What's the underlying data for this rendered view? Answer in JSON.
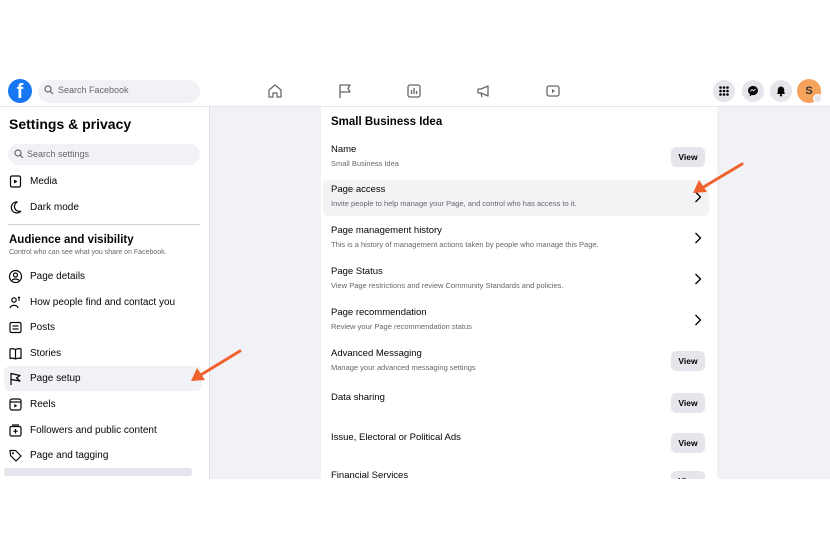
{
  "topbar": {
    "logo_letter": "f",
    "search_placeholder": "Search Facebook",
    "avatar_letter": "S"
  },
  "sidebar": {
    "title": "Settings & privacy",
    "search_placeholder": "Search settings",
    "top_items": [
      {
        "label": "Media",
        "icon": "media-icon"
      },
      {
        "label": "Dark mode",
        "icon": "moon-icon"
      }
    ],
    "section_title": "Audience and visibility",
    "section_subtitle": "Control who can see what you share on Facebook.",
    "items": [
      {
        "label": "Page details",
        "icon": "user-circle-icon"
      },
      {
        "label": "How people find and contact you",
        "icon": "people-icon"
      },
      {
        "label": "Posts",
        "icon": "posts-icon"
      },
      {
        "label": "Stories",
        "icon": "book-icon"
      },
      {
        "label": "Page setup",
        "icon": "flag-icon"
      },
      {
        "label": "Reels",
        "icon": "reels-icon"
      },
      {
        "label": "Followers and public content",
        "icon": "followers-icon"
      },
      {
        "label": "Page and tagging",
        "icon": "tag-icon"
      }
    ]
  },
  "main": {
    "title": "Small Business Idea",
    "view_label": "View",
    "rows": [
      {
        "title": "Name",
        "desc": "Small Business Idea",
        "action": "view"
      },
      {
        "title": "Page access",
        "desc": "Invite people to help manage your Page, and control who has access to it.",
        "action": "chevron"
      },
      {
        "title": "Page management history",
        "desc": "This is a history of management actions taken by people who manage this Page.",
        "action": "chevron"
      },
      {
        "title": "Page Status",
        "desc": "View Page restrictions and review Community Standards and policies.",
        "action": "chevron"
      },
      {
        "title": "Page recommendation",
        "desc": "Review your Page recommendation status",
        "action": "chevron"
      },
      {
        "title": "Advanced Messaging",
        "desc": "Manage your advanced messaging settings",
        "action": "view"
      },
      {
        "title": "Data sharing",
        "desc": "",
        "action": "view"
      },
      {
        "title": "Issue, Electoral or Political Ads",
        "desc": "",
        "action": "view"
      },
      {
        "title": "Financial Services",
        "desc": "",
        "action": "view"
      }
    ]
  },
  "colors": {
    "brand": "#1877f2",
    "arrow": "#f0622d",
    "avatar": "#f5a25d"
  }
}
